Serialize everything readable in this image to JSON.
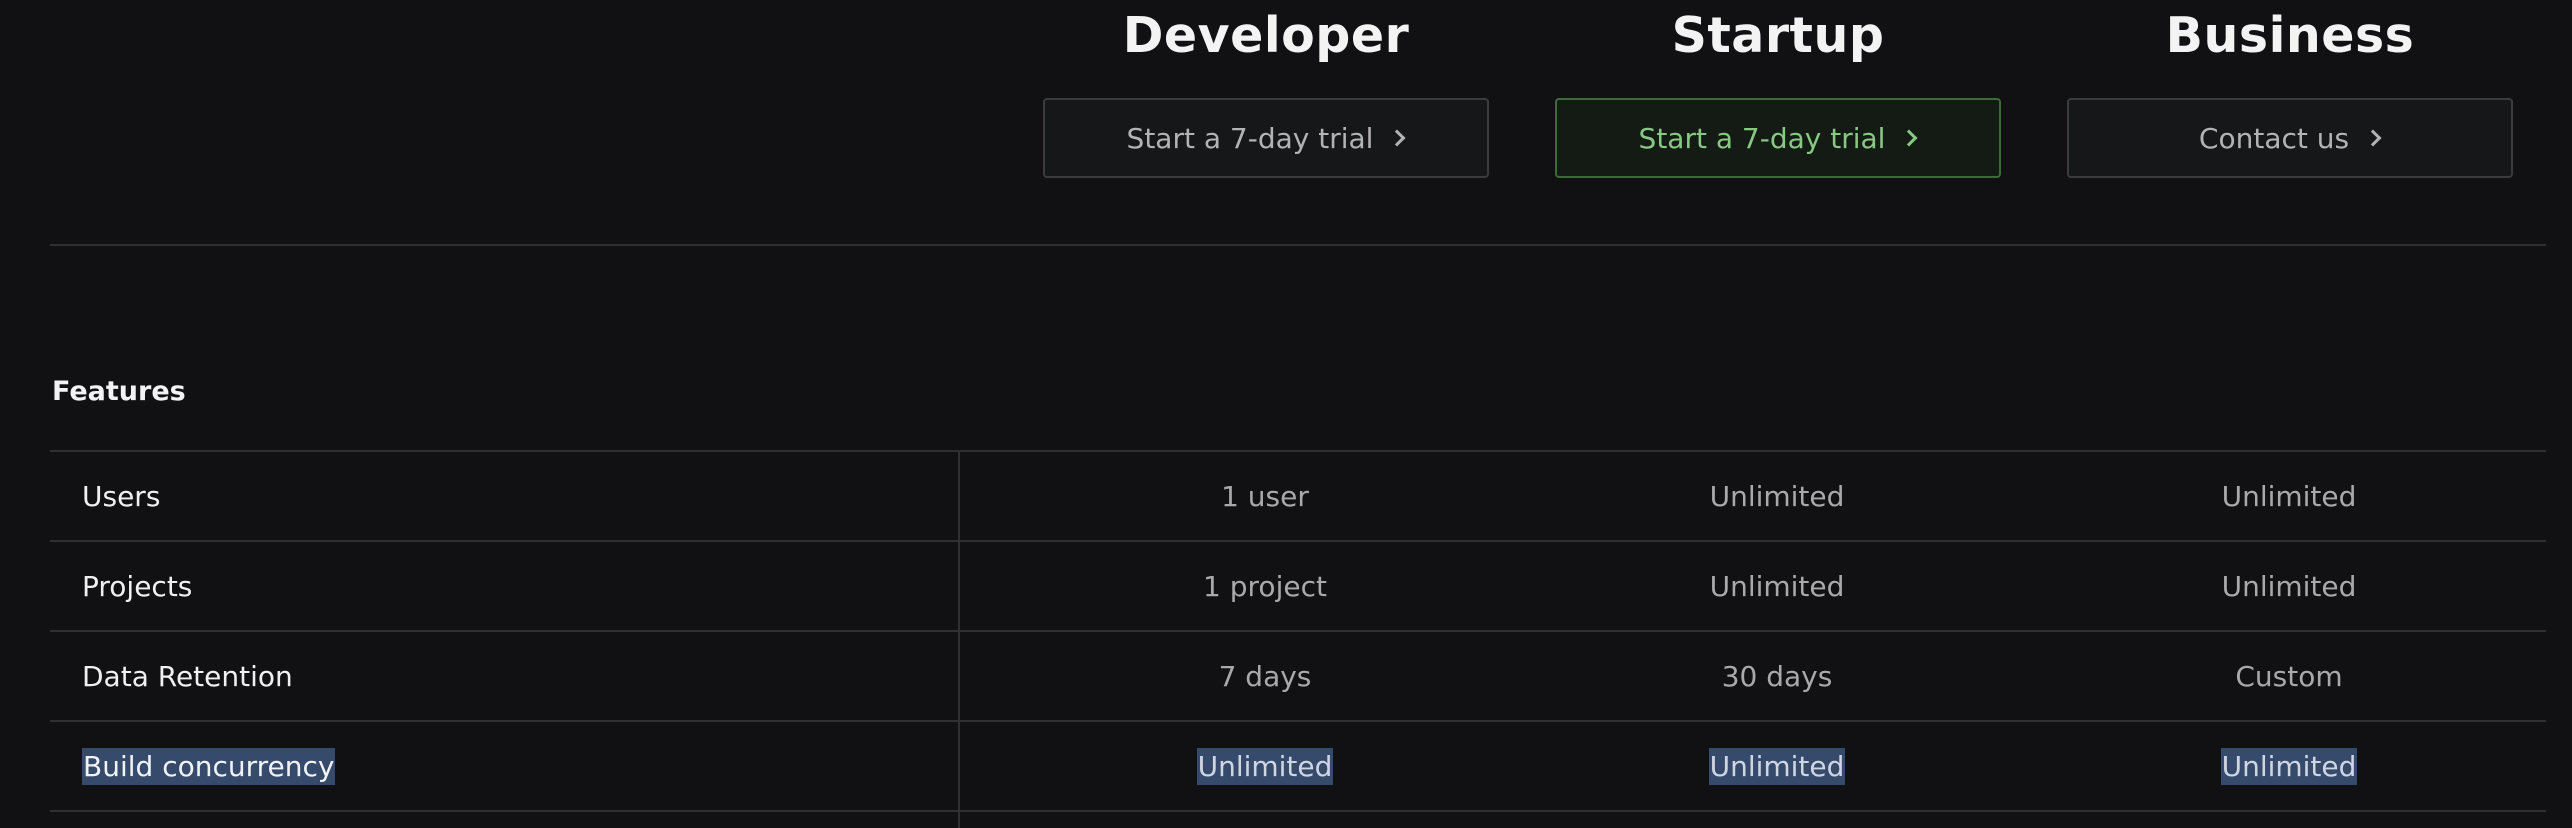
{
  "plans": [
    {
      "name": "Developer",
      "cta": "Start a 7-day trial"
    },
    {
      "name": "Startup",
      "cta": "Start a 7-day trial",
      "highlighted": true
    },
    {
      "name": "Business",
      "cta": "Contact us"
    }
  ],
  "colors": {
    "background": "#111113",
    "accent_green": "#88c883",
    "selection": "#364a6b"
  },
  "features": {
    "heading": "Features",
    "rows": [
      {
        "label": "Users",
        "values": [
          "1 user",
          "Unlimited",
          "Unlimited"
        ]
      },
      {
        "label": "Projects",
        "values": [
          "1 project",
          "Unlimited",
          "Unlimited"
        ]
      },
      {
        "label": "Data Retention",
        "values": [
          "7 days",
          "30 days",
          "Custom"
        ]
      },
      {
        "label": "Build concurrency",
        "values": [
          "Unlimited",
          "Unlimited",
          "Unlimited"
        ],
        "selected": true
      }
    ]
  }
}
